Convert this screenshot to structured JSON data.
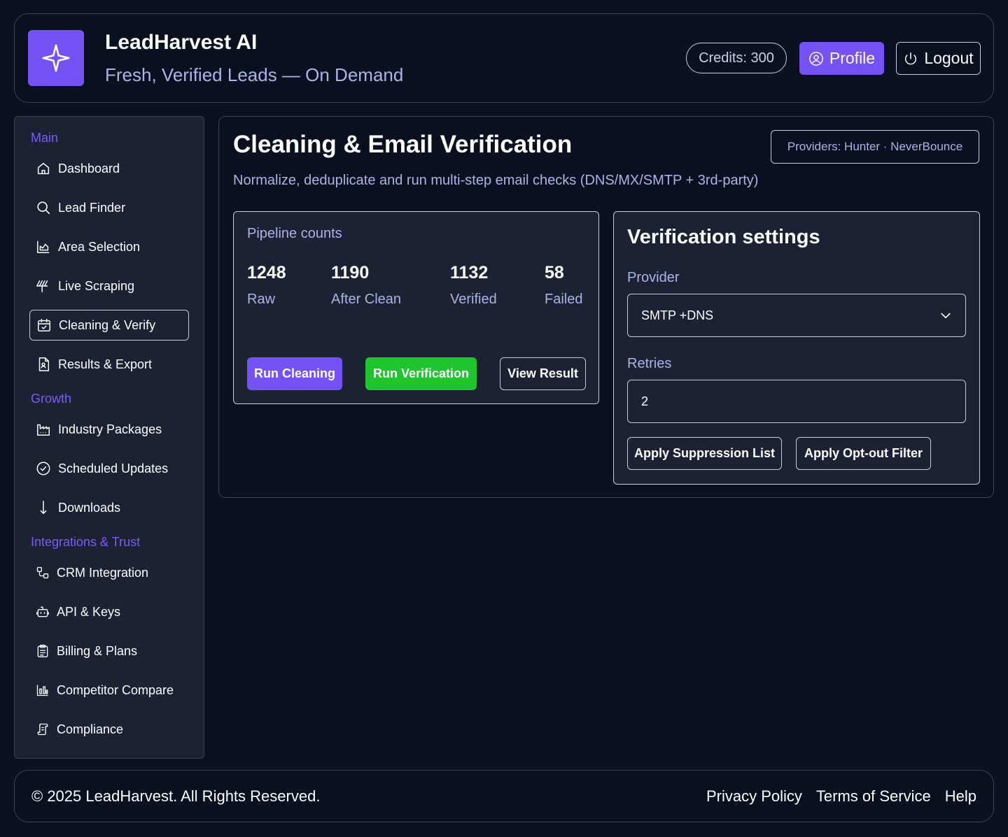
{
  "header": {
    "title": "LeadHarvest AI",
    "subtitle": "Fresh, Verified Leads — On Demand",
    "credits": "Credits: 300",
    "profile_label": "Profile",
    "logout_label": "Logout"
  },
  "sidebar": {
    "sections": [
      {
        "label": "Main"
      },
      {
        "label": "Growth"
      },
      {
        "label": "Integrations & Trust"
      }
    ],
    "items": [
      {
        "label": "Dashboard",
        "icon": "home-icon"
      },
      {
        "label": "Lead Finder",
        "icon": "search-icon"
      },
      {
        "label": "Area Selection",
        "icon": "chart-area-icon"
      },
      {
        "label": "Live Scraping",
        "icon": "live-scraping-icon"
      },
      {
        "label": "Cleaning & Verify",
        "icon": "calendar-check-icon",
        "active": true
      },
      {
        "label": "Results & Export",
        "icon": "file-user-icon"
      },
      {
        "label": "Industry Packages",
        "icon": "factory-icon"
      },
      {
        "label": "Scheduled Updates",
        "icon": "badge-check-icon"
      },
      {
        "label": "Downloads",
        "icon": "arrow-down-icon"
      },
      {
        "label": "CRM Integration",
        "icon": "workflow-icon"
      },
      {
        "label": "API & Keys",
        "icon": "bot-icon"
      },
      {
        "label": "Billing & Plans",
        "icon": "clipboard-list-icon"
      },
      {
        "label": "Competitor Compare",
        "icon": "bar-chart-icon"
      },
      {
        "label": "Compliance",
        "icon": "scroll-icon"
      }
    ]
  },
  "main": {
    "title": "Cleaning & Email Verification",
    "providers": "Providers: Hunter · NeverBounce",
    "description": "Normalize, deduplicate and run multi-step email checks (DNS/MX/SMTP + 3rd-party)",
    "pipeline": {
      "title": "Pipeline counts",
      "stats": [
        {
          "value": "1248",
          "label": "Raw"
        },
        {
          "value": "1190",
          "label": "After Clean"
        },
        {
          "value": "1132",
          "label": "Verified"
        },
        {
          "value": "58",
          "label": "Failed"
        }
      ],
      "run_cleaning": "Run Cleaning",
      "run_verification": "Run Verification",
      "view_result": "View Result"
    },
    "verification": {
      "title": "Verification settings",
      "provider_label": "Provider",
      "provider_value": "SMTP +DNS",
      "retries_label": "Retries",
      "retries_value": "2",
      "suppression_btn": "Apply Suppression List",
      "optout_btn": "Apply Opt-out Filter"
    }
  },
  "footer": {
    "copyright": "© 2025 LeadHarvest. All Rights Reserved.",
    "links": [
      "Privacy Policy",
      "Terms of Service",
      "Help"
    ]
  },
  "colors": {
    "background": "#0b1020",
    "panel": "#1c2233",
    "accent": "#7452f5",
    "success": "#1ec52f",
    "muted_text": "#aab4e6"
  }
}
